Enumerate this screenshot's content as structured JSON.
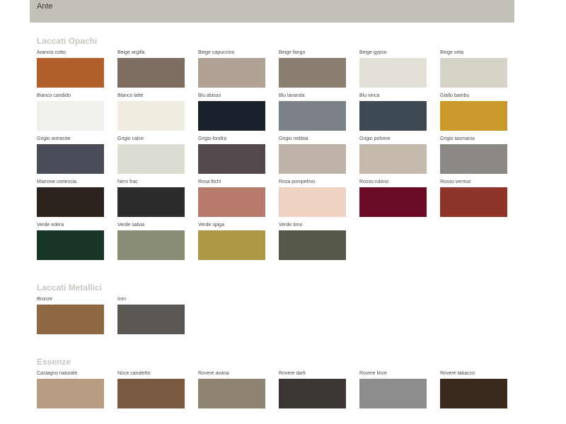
{
  "header": {
    "title": "Ante"
  },
  "sections": [
    {
      "title": "Laccati Opachi",
      "swatches": [
        {
          "label": "Arancio cotto",
          "color": "#b35f2c"
        },
        {
          "label": "Beige argilla",
          "color": "#7d6e61"
        },
        {
          "label": "Beige capuccino",
          "color": "#b0a294"
        },
        {
          "label": "Beige fango",
          "color": "#8a7f71"
        },
        {
          "label": "Beige gypso",
          "color": "#e3e0d7"
        },
        {
          "label": "Beige seta",
          "color": "#d8d3c9"
        },
        {
          "label": "Bianco candido",
          "color": "#f1f0ea"
        },
        {
          "label": "Bianco latte",
          "color": "#f0ede0"
        },
        {
          "label": "Blu abisso",
          "color": "#1c222b"
        },
        {
          "label": "Blu lavanda",
          "color": "#7c8088"
        },
        {
          "label": "Blu vinca",
          "color": "#3e4954"
        },
        {
          "label": "Giallo bambu",
          "color": "#c9992b"
        },
        {
          "label": "Grigio antracite",
          "color": "#4a4d57"
        },
        {
          "label": "Grigio calce",
          "color": "#dcddd3"
        },
        {
          "label": "Grigio londra",
          "color": "#54494a"
        },
        {
          "label": "Grigio nebbia",
          "color": "#beb3a9"
        },
        {
          "label": "Grigio polvere",
          "color": "#c5b9ae"
        },
        {
          "label": "Grigio tasmania",
          "color": "#8b8782"
        },
        {
          "label": "Marrone corteccia",
          "color": "#2c231d"
        },
        {
          "label": "Nero frac",
          "color": "#2c2c2c"
        },
        {
          "label": "Rosa litchi",
          "color": "#b7796b"
        },
        {
          "label": "Rosa pompelmo",
          "color": "#f0d2c3"
        },
        {
          "label": "Rosso rubino",
          "color": "#6a0b25"
        },
        {
          "label": "Rosso vermut",
          "color": "#8f3429"
        },
        {
          "label": "Verde edera",
          "color": "#173524"
        },
        {
          "label": "Verde salvia",
          "color": "#878c75"
        },
        {
          "label": "Verde spiga",
          "color": "#ae9847"
        },
        {
          "label": "Verde timo",
          "color": "#545848"
        }
      ]
    },
    {
      "title": "Laccati Metallici",
      "swatches": [
        {
          "label": "Bronze",
          "color": "#8e6745"
        },
        {
          "label": "Iron",
          "color": "#5a5753"
        }
      ]
    },
    {
      "title": "Essenze",
      "swatches": [
        {
          "label": "Castagno naturale",
          "color": "#b89d83"
        },
        {
          "label": "Noce canaletto",
          "color": "#7a5a40"
        },
        {
          "label": "Rovere avana",
          "color": "#8f846f"
        },
        {
          "label": "Rovere dark",
          "color": "#3b3633"
        },
        {
          "label": "Rovere lince",
          "color": "#8c8b8d"
        },
        {
          "label": "Rovere tabacco",
          "color": "#3a2a20"
        }
      ]
    }
  ]
}
